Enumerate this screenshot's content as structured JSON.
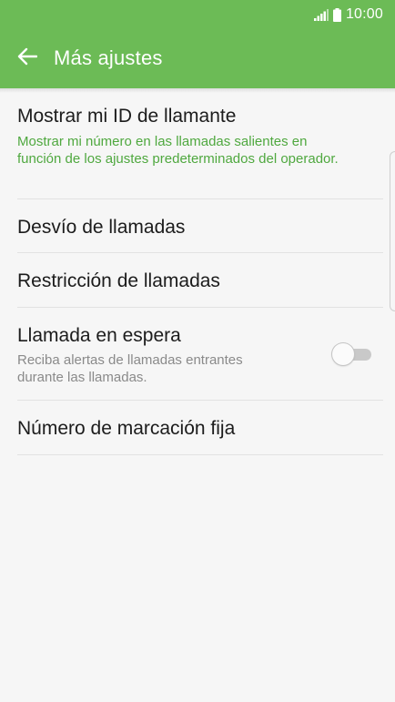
{
  "status_bar": {
    "time": "10:00",
    "signal_icon": "signal-icon",
    "battery_icon": "battery-icon"
  },
  "header": {
    "title": "Más ajustes",
    "back_icon": "arrow-left-icon",
    "background_color": "#6cbb56"
  },
  "settings": [
    {
      "title": "Mostrar mi ID de llamante",
      "subtitle": "Mostrar mi número en las llamadas salientes en función de los ajustes predeterminados del operador.",
      "subtitle_color": "#4fa83f"
    },
    {
      "title": "Desvío de llamadas"
    },
    {
      "title": "Restricción de llamadas"
    },
    {
      "title": "Llamada en espera",
      "subtitle": "Reciba alertas de llamadas entrantes durante las llamadas.",
      "toggle_on": false
    },
    {
      "title": "Número de marcación fija"
    }
  ]
}
